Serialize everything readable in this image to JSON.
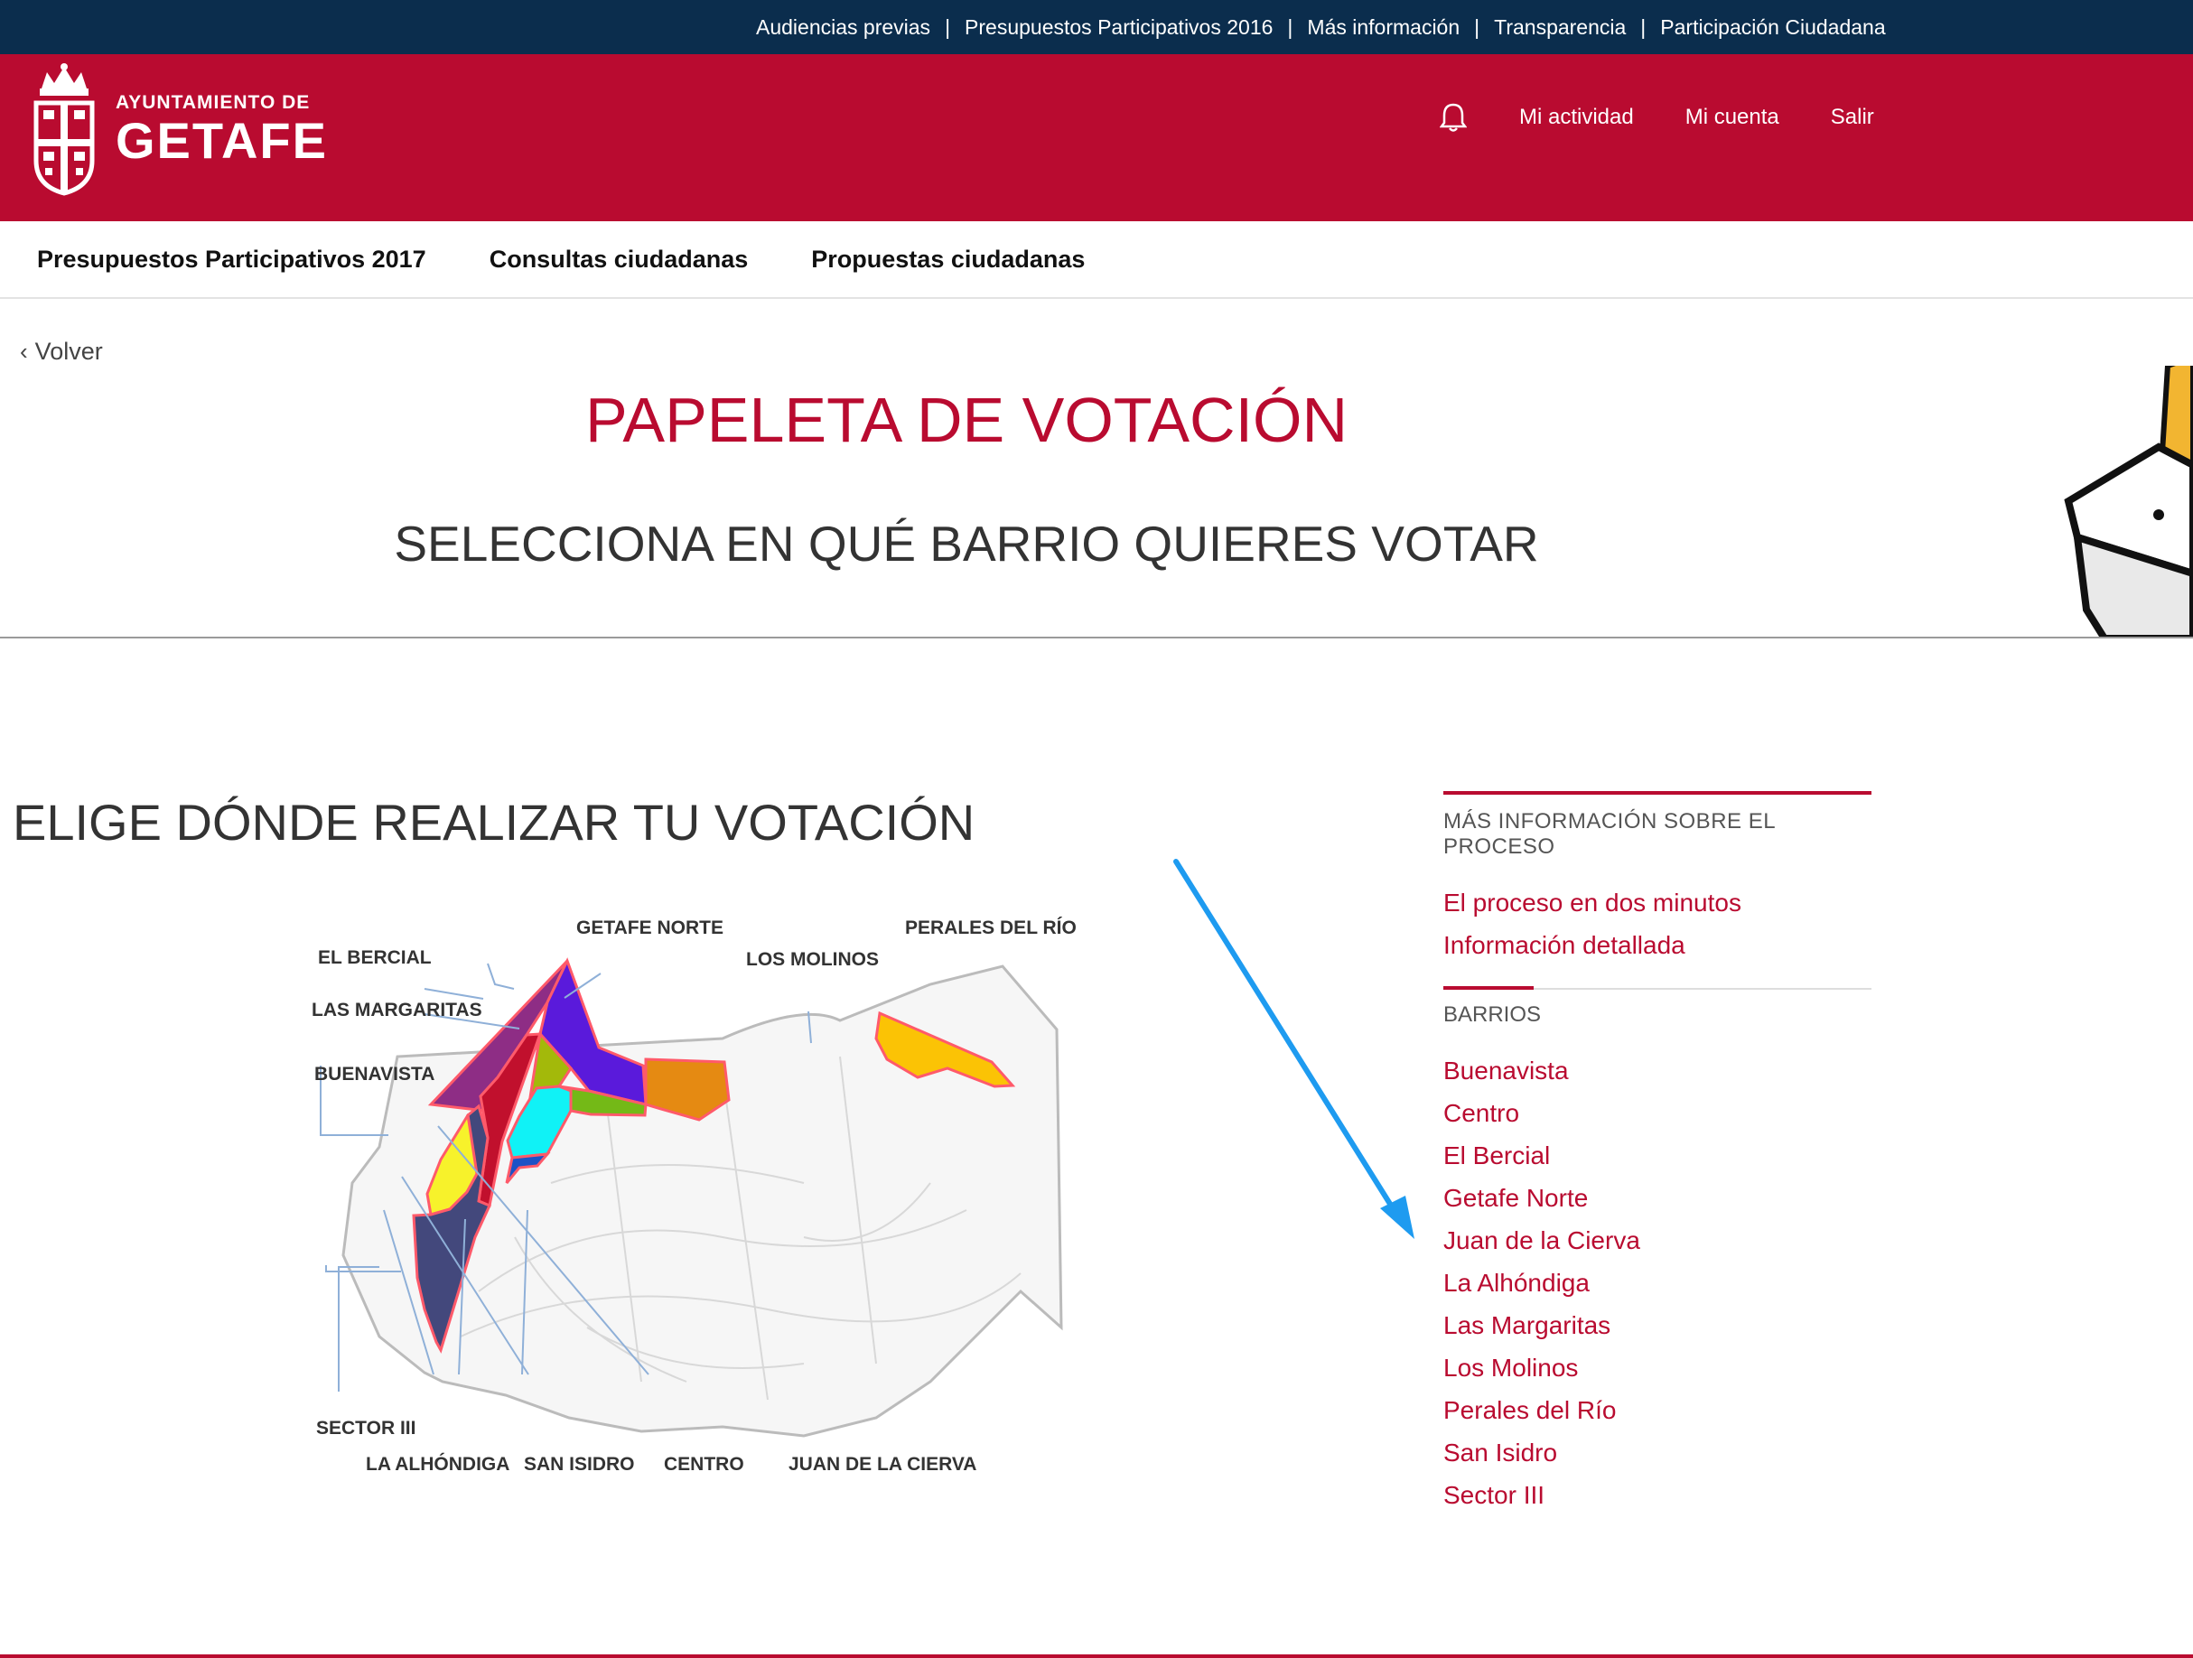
{
  "topbar": {
    "links": [
      "Audiencias previas",
      "Presupuestos Participativos 2016",
      "Más información",
      "Transparencia",
      "Participación Ciudadana"
    ]
  },
  "header": {
    "logo_line1": "AYUNTAMIENTO DE",
    "logo_line2": "GETAFE",
    "nav": [
      "Mi actividad",
      "Mi cuenta",
      "Salir"
    ]
  },
  "mainnav": [
    "Presupuestos Participativos 2017",
    "Consultas ciudadanas",
    "Propuestas ciudadanas"
  ],
  "back_label": "Volver",
  "title": "PAPELETA DE VOTACIÓN",
  "subtitle": "SELECCIONA EN QUÉ BARRIO QUIERES VOTAR",
  "section_title": "ELIGE DÓNDE REALIZAR TU VOTACIÓN",
  "map": {
    "labels": [
      "EL BERCIAL",
      "GETAFE NORTE",
      "LOS MOLINOS",
      "PERALES DEL RÍO",
      "LAS MARGARITAS",
      "BUENAVISTA",
      "SECTOR III",
      "LA ALHÓNDIGA",
      "SAN ISIDRO",
      "CENTRO",
      "JUAN DE LA CIERVA"
    ]
  },
  "sidebar": {
    "info_heading": "MÁS INFORMACIÓN SOBRE EL PROCESO",
    "info_links": [
      "El proceso en dos minutos",
      "Información detallada"
    ],
    "barrios_heading": "BARRIOS",
    "barrios": [
      "Buenavista",
      "Centro",
      "El Bercial",
      "Getafe Norte",
      "Juan de la Cierva",
      "La Alhóndiga",
      "Las Margaritas",
      "Los Molinos",
      "Perales del Río",
      "San Isidro",
      "Sector III"
    ]
  },
  "colors": {
    "brand_red": "#b90b30",
    "topbar_navy": "#0b2d4d",
    "annotation_blue": "#1e9bf0"
  }
}
